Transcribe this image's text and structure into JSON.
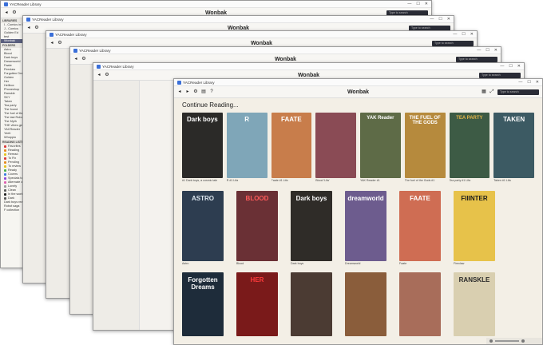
{
  "app": {
    "window_title": "YACReader Library",
    "library_name": "Wonbak",
    "search_placeholder": "Type to search",
    "controls": [
      "—",
      "☐",
      "✕"
    ]
  },
  "libraries_header": "LIBRARIES",
  "libraries": [
    "I - Comics in English",
    "J - Comics",
    "Golden Ed",
    "test",
    "Wonbak"
  ],
  "folders_header": "FOLDERS",
  "folders": [
    "Astro",
    "Blood",
    "Dark boys",
    "Dreamworld",
    "Faate",
    "Fireclaw",
    "Forgotten Dreams",
    "Golden",
    "Her",
    "Hellbox",
    "Phoneshop",
    "Ranskle",
    "SKY",
    "Taken",
    "Tea party",
    "The found",
    "The fuel of the Gods",
    "The last Robot",
    "The Myth",
    "THE vibes generator",
    "YACReader",
    "Yeeti",
    "Whoppio"
  ],
  "reading_lists_header": "READING LISTS",
  "reading_lists": [
    {
      "label": "Favorites",
      "color": "#d93b3b"
    },
    {
      "label": "Reading",
      "color": "#e58a1f"
    },
    {
      "label": "Reread",
      "color": "#e4c21d"
    },
    {
      "label": "To Fix",
      "color": "#d93b3b"
    },
    {
      "label": "Pending",
      "color": "#e58a1f"
    },
    {
      "label": "To review",
      "color": "#e4c21d"
    },
    {
      "label": "Ready",
      "color": "#4bb04b"
    },
    {
      "label": "Covers",
      "color": "#3a7be0"
    },
    {
      "label": "Specials to read",
      "color": "#8a4bd9"
    },
    {
      "label": "Alternate covers",
      "color": "#e05fb0"
    },
    {
      "label": "Lonely",
      "color": "#9a9a9a"
    },
    {
      "label": "Clean",
      "color": "#5a5a5a"
    },
    {
      "label": "In the works",
      "color": "#222222"
    },
    {
      "label": "Dark",
      "color": "#555555"
    },
    {
      "label": "Dark boys reading order",
      "color": "#888888"
    },
    {
      "label": "Robot saga",
      "color": "#888888"
    },
    {
      "label": "F collection",
      "color": "#888888"
    }
  ],
  "continue_reading": "Continue Reading...",
  "row1": [
    {
      "title": "Dark boys",
      "caption": "#1 Dark boys, a cosmic tale",
      "bg": "#2b2a28",
      "fg": "#ffffff"
    },
    {
      "title": "R",
      "caption": "R #1 Lifa",
      "bg": "#7fa6b8",
      "fg": "#ffffff"
    },
    {
      "title": "FAATE",
      "caption": "Faate #1 Lifa",
      "bg": "#c87d4b",
      "fg": "#ffffff"
    },
    {
      "title": "",
      "caption": "Blood 'Lifa'",
      "bg": "#8a4b55",
      "fg": "#ffffff"
    },
    {
      "title": "YAK Reader",
      "caption": "YAK Reader #1",
      "bg": "#5e6b47",
      "fg": "#ffffff"
    },
    {
      "title": "THE FUEL OF THE GODS",
      "caption": "The fuel of the Gods #1",
      "bg": "#b68a3d",
      "fg": "#ffffff"
    },
    {
      "title": "TEA PARTY",
      "caption": "Tea party #1 Lifa",
      "bg": "#3d5b45",
      "fg": "#e3b54a"
    },
    {
      "title": "TAKEN",
      "caption": "Taken #1 Lifa",
      "bg": "#3c5a63",
      "fg": "#ffffff"
    }
  ],
  "row2": [
    {
      "title": "ASTRO",
      "caption": "Astro",
      "bg": "#2d3d50",
      "fg": "#dde6ee"
    },
    {
      "title": "BLOOD",
      "caption": "Blood",
      "bg": "#6a3035",
      "fg": "#ff5a5a"
    },
    {
      "title": "Dark boys",
      "caption": "Dark boys",
      "bg": "#2f2c28",
      "fg": "#ffffff"
    },
    {
      "title": "dreamworld",
      "caption": "Dreamworld",
      "bg": "#6d5c8e",
      "fg": "#ffffff"
    },
    {
      "title": "FAATE",
      "caption": "Faate",
      "bg": "#cf6d53",
      "fg": "#ffffff"
    },
    {
      "title": "FIIINTER",
      "caption": "Fireclaw",
      "bg": "#e7c24a",
      "fg": "#1a1a1a"
    }
  ],
  "row3": [
    {
      "title": "Forgotten Dreams",
      "bg": "#1e2c3a",
      "fg": "#ffffff"
    },
    {
      "title": "HER",
      "bg": "#7a1a1a",
      "fg": "#ff3a3a"
    },
    {
      "title": "",
      "bg": "#4b3b33",
      "fg": "#ffffff"
    },
    {
      "title": "",
      "bg": "#8a5d3b",
      "fg": "#ffffff"
    },
    {
      "title": "",
      "bg": "#a86d5a",
      "fg": "#ffffff"
    },
    {
      "title": "RANSKLE",
      "bg": "#d9cfb0",
      "fg": "#2a2a2a"
    }
  ]
}
